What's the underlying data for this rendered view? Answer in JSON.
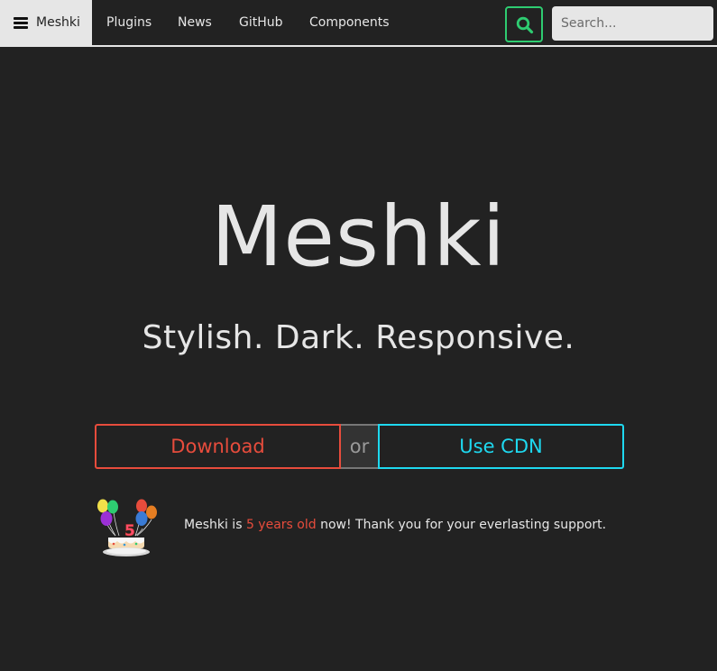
{
  "nav": {
    "brand": "Meshki",
    "links": [
      "Plugins",
      "News",
      "GitHub",
      "Components"
    ],
    "search_placeholder": "Search..."
  },
  "hero": {
    "title": "Meshki",
    "tagline": "Stylish. Dark. Responsive."
  },
  "actions": {
    "download": "Download",
    "or": "or",
    "cdn": "Use CDN"
  },
  "announcement": {
    "before": "Meshki is",
    "highlight": "5 years old",
    "after": "now! Thank you for your everlasting support.",
    "cake_number": "5"
  },
  "colors": {
    "background": "#222222",
    "text": "#e6e6e6",
    "download": "#e74c3c",
    "cdn": "#1ed9f0",
    "search": "#2ecc71"
  },
  "icons": {
    "menu": "hamburger-icon",
    "search": "search-icon",
    "celebration": "birthday-cake-icon"
  }
}
